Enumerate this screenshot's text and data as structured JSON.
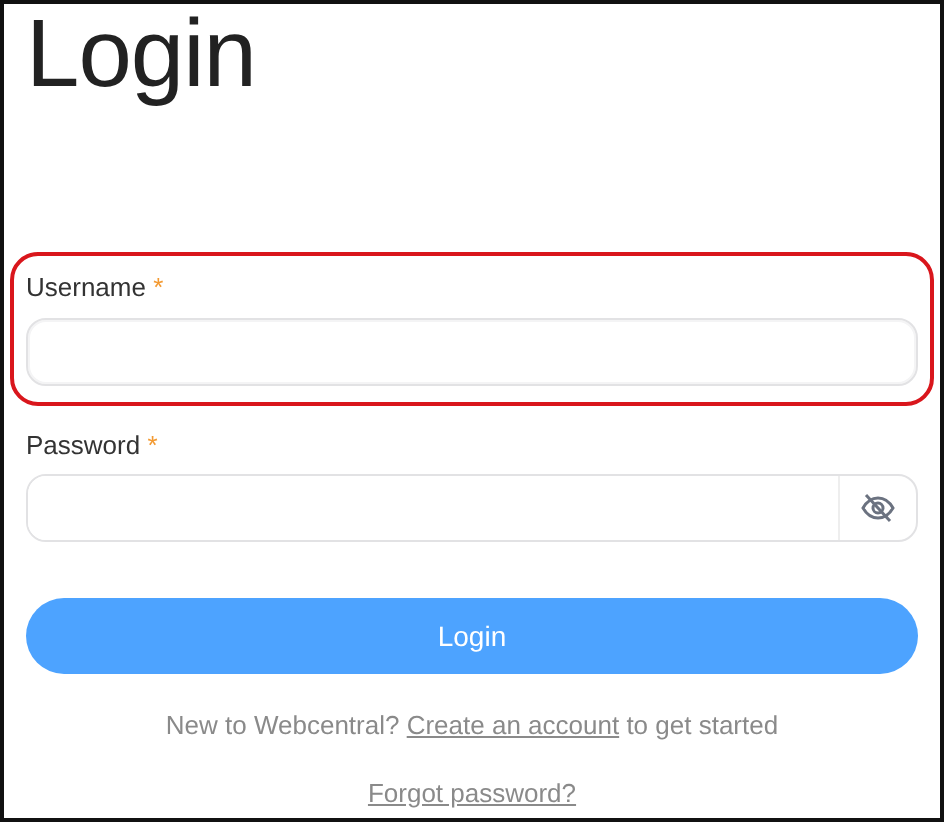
{
  "title": "Login",
  "fields": [
    {
      "kind": "text",
      "label": "Username",
      "required_mark": "*",
      "highlighted": true
    },
    {
      "kind": "password",
      "label": "Password",
      "required_mark": "*",
      "highlighted": false,
      "password_hidden": true
    }
  ],
  "submit_button": "Login",
  "signup": {
    "before": "New to Webcentral? ",
    "link": "Create an account",
    "after": " to get started"
  },
  "forgot_link": "Forgot password?"
}
